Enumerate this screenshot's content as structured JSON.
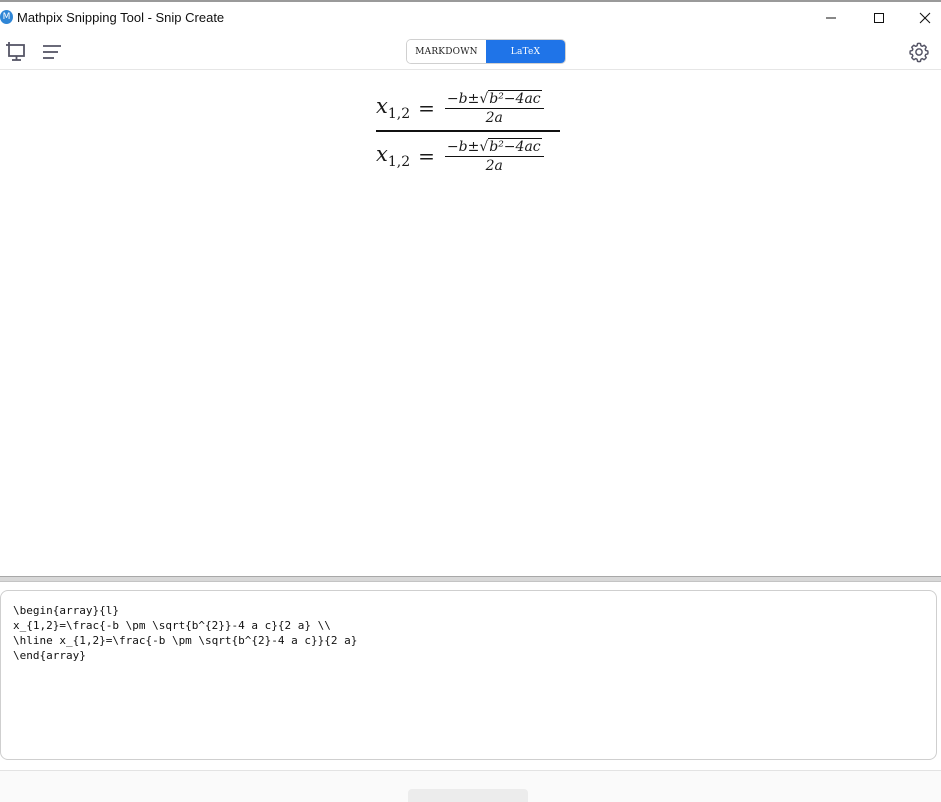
{
  "window": {
    "title": "Mathpix Snipping Tool - Snip Create",
    "app_icon_glyph": "M"
  },
  "toolbar": {
    "tabs": [
      {
        "label": "MARKDOWN",
        "active": false
      },
      {
        "label": "LaTeX",
        "active": true
      }
    ],
    "accent_color": "#1f74e8"
  },
  "rendered": {
    "rows": [
      {
        "lhs": "x",
        "sub": "1,2",
        "eq": "=",
        "num_pre": "−b±",
        "radicand": "b²−4ac",
        "den": "2a"
      },
      {
        "lhs": "x",
        "sub": "1,2",
        "eq": "=",
        "num_pre": "−b±",
        "radicand": "b²−4ac",
        "den": "2a"
      }
    ]
  },
  "code": {
    "lines": [
      "\\begin{array}{l}",
      "x_{1,2}=\\frac{-b \\pm \\sqrt{b^{2}}-4 a c}{2 a} \\\\",
      "\\hline x_{1,2}=\\frac{-b \\pm \\sqrt{b^{2}-4 a c}}{2 a}",
      "\\end{array}"
    ]
  },
  "icons": {
    "snip": "snip-screen-icon",
    "menu": "menu-lines-icon",
    "settings": "gear-icon",
    "minimize": "minimize-icon",
    "maximize": "maximize-icon",
    "close": "close-icon"
  }
}
